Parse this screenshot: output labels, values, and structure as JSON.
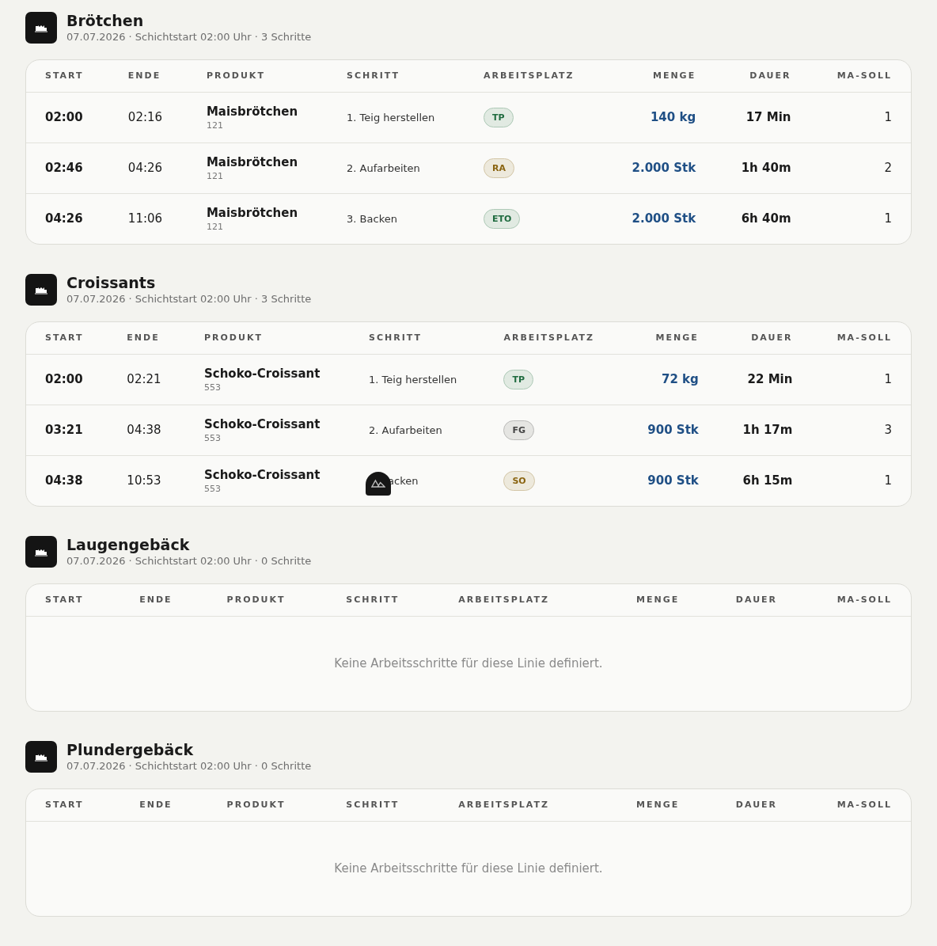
{
  "lines": [
    {
      "title": "Brötchen",
      "subtitle": "07.07.2026 · Schichtstart 02:00 Uhr · 3 Schritte",
      "columns": [
        "START",
        "ENDE",
        "PRODUKT",
        "SCHRITT",
        "ARBEITSPLATZ",
        "MENGE",
        "DAUER",
        "MA-SOLL"
      ],
      "rows": [
        {
          "start": "02:00",
          "end": "02:16",
          "product": "Maisbrötchen",
          "product_no": "121",
          "step": "1. Teig herstellen",
          "workplace": {
            "label": "TP",
            "color": "#1f6b3f"
          },
          "amount": "140 kg",
          "duration": "17 Min",
          "staff": "1"
        },
        {
          "start": "02:46",
          "end": "04:26",
          "product": "Maisbrötchen",
          "product_no": "121",
          "step": "2. Aufarbeiten",
          "workplace": {
            "label": "RA",
            "color": "#8a6410"
          },
          "amount": "2.000 Stk",
          "duration": "1h 40m",
          "staff": "2"
        },
        {
          "start": "04:26",
          "end": "11:06",
          "product": "Maisbrötchen",
          "product_no": "121",
          "step": "3. Backen",
          "workplace": {
            "label": "ETO",
            "color": "#1f6b3f"
          },
          "amount": "2.000 Stk",
          "duration": "6h 40m",
          "staff": "1"
        }
      ]
    },
    {
      "title": "Croissants",
      "subtitle": "07.07.2026 · Schichtstart 02:00 Uhr · 3 Schritte",
      "columns": [
        "START",
        "ENDE",
        "PRODUKT",
        "SCHRITT",
        "ARBEITSPLATZ",
        "MENGE",
        "DAUER",
        "MA-SOLL"
      ],
      "rows": [
        {
          "start": "02:00",
          "end": "02:21",
          "product": "Schoko-Croissant",
          "product_no": "553",
          "step": "1. Teig herstellen",
          "workplace": {
            "label": "TP",
            "color": "#1f6b3f"
          },
          "amount": "72 kg",
          "duration": "22 Min",
          "staff": "1"
        },
        {
          "start": "03:21",
          "end": "04:38",
          "product": "Schoko-Croissant",
          "product_no": "553",
          "step": "2. Aufarbeiten",
          "workplace": {
            "label": "FG",
            "color": "#444444"
          },
          "amount": "900 Stk",
          "duration": "1h 17m",
          "staff": "3"
        },
        {
          "start": "04:38",
          "end": "10:53",
          "product": "Schoko-Croissant",
          "product_no": "553",
          "step": "acken",
          "overlay": true,
          "workplace": {
            "label": "SO",
            "color": "#8a6410"
          },
          "amount": "900 Stk",
          "duration": "6h 15m",
          "staff": "1"
        }
      ]
    },
    {
      "title": "Laugengebäck",
      "subtitle": "07.07.2026 · Schichtstart 02:00 Uhr · 0 Schritte",
      "columns": [
        "START",
        "ENDE",
        "PRODUKT",
        "SCHRITT",
        "ARBEITSPLATZ",
        "MENGE",
        "DAUER",
        "MA-SOLL"
      ],
      "empty": "Keine Arbeitsschritte für diese Linie definiert."
    },
    {
      "title": "Plundergebäck",
      "subtitle": "07.07.2026 · Schichtstart 02:00 Uhr · 0 Schritte",
      "columns": [
        "START",
        "ENDE",
        "PRODUKT",
        "SCHRITT",
        "ARBEITSPLATZ",
        "MENGE",
        "DAUER",
        "MA-SOLL"
      ],
      "empty": "Keine Arbeitsschritte für diese Linie definiert."
    }
  ]
}
